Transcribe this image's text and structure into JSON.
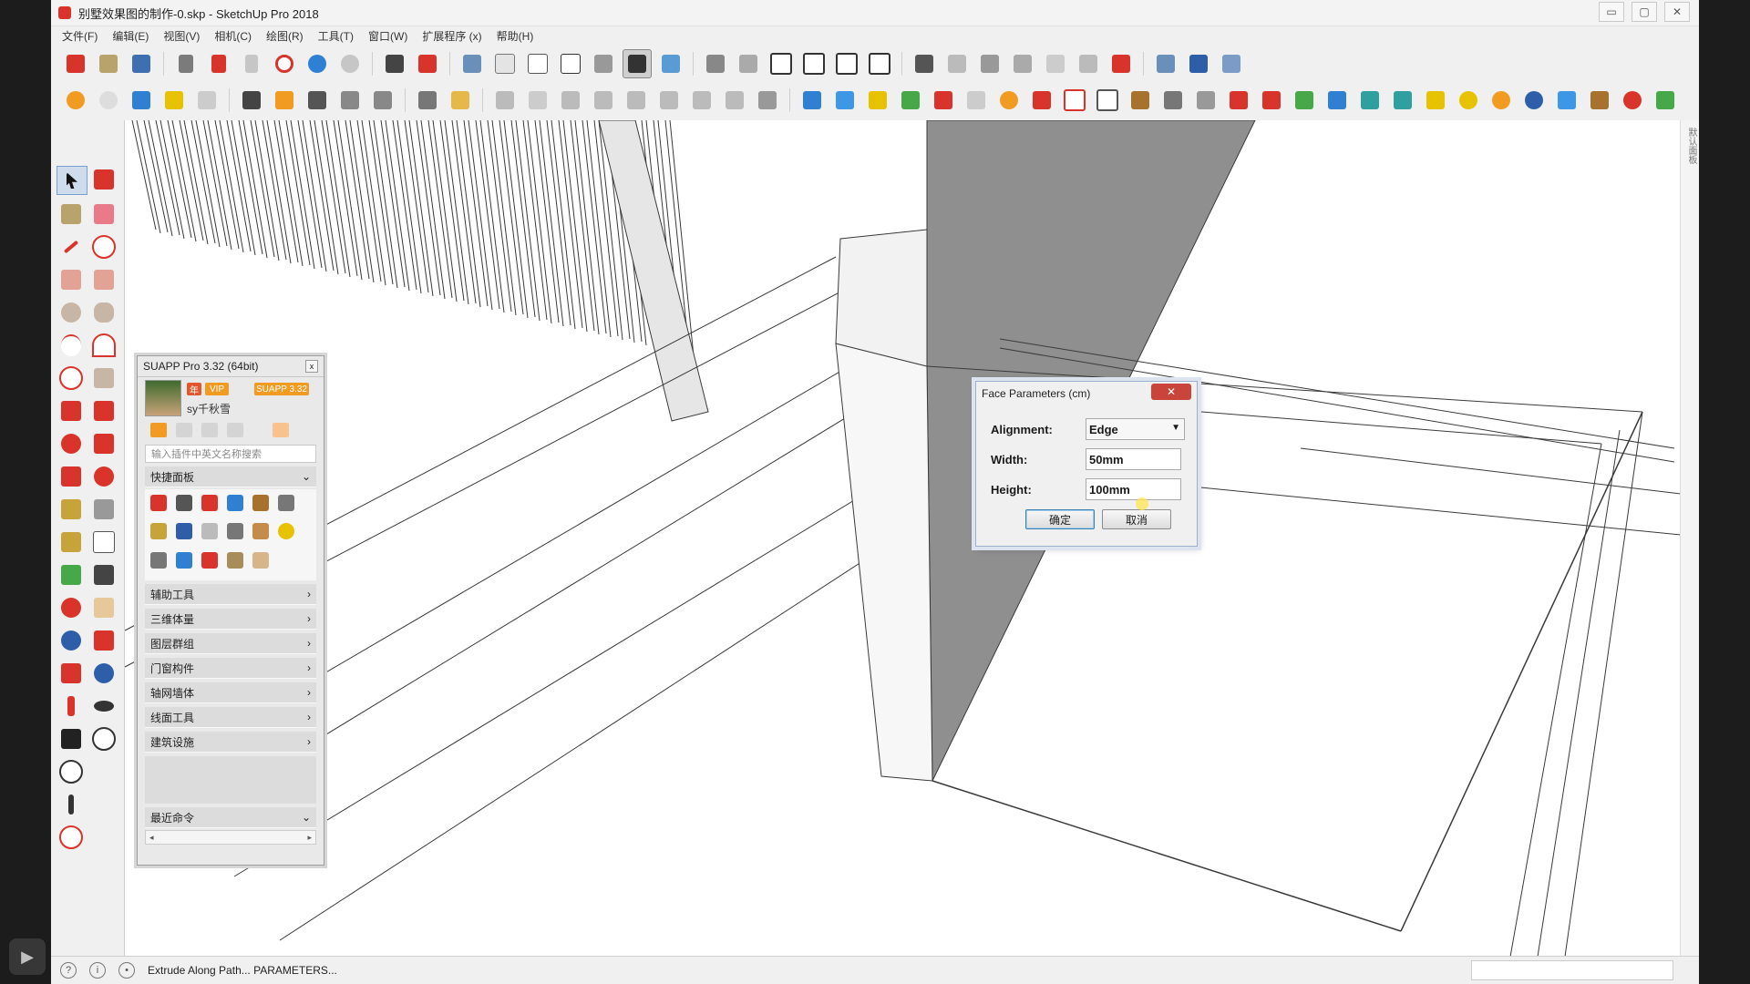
{
  "window": {
    "title": "别墅效果图的制作-0.skp - SketchUp Pro 2018",
    "controls": [
      "▭",
      "▢",
      "✕"
    ]
  },
  "menu": [
    "文件(F)",
    "编辑(E)",
    "视图(V)",
    "相机(C)",
    "绘图(R)",
    "工具(T)",
    "窗口(W)",
    "扩展程序 (x)",
    "帮助(H)"
  ],
  "right_panel_vertical_text": "默认面板",
  "suapp": {
    "title": "SUAPP Pro 3.32 (64bit)",
    "close": "x",
    "badge_year": "年",
    "badge_vip": "VIP",
    "badge_version": "SUAPP 3.32",
    "username": "sy千秋雪",
    "search_placeholder": "输入插件中英文名称搜索",
    "quick_panel": "快捷面板",
    "sections": [
      "辅助工具",
      "三维体量",
      "图层群组",
      "门窗构件",
      "轴网墙体",
      "线面工具",
      "建筑设施"
    ],
    "recent": "最近命令",
    "chevron": "›",
    "chevron_down": "⌄",
    "scroll_left": "◂",
    "scroll_right": "▸"
  },
  "dialog": {
    "title": "Face Parameters (cm)",
    "close": "✕",
    "alignment_label": "Alignment:",
    "alignment_value": "Edge",
    "width_label": "Width:",
    "width_value": "50mm",
    "height_label": "Height:",
    "height_value": "100mm",
    "ok": "确定",
    "cancel": "取消"
  },
  "status": {
    "text": "Extrude Along Path... PARAMETERS..."
  },
  "colors": {
    "accent": "#d9342b",
    "toolbar_blue": "#2f7fd3",
    "toolbar_green": "#47a84a",
    "toolbar_orange": "#f29b22",
    "face_gray": "#8f8f8f",
    "line": "#3a3a3a"
  }
}
